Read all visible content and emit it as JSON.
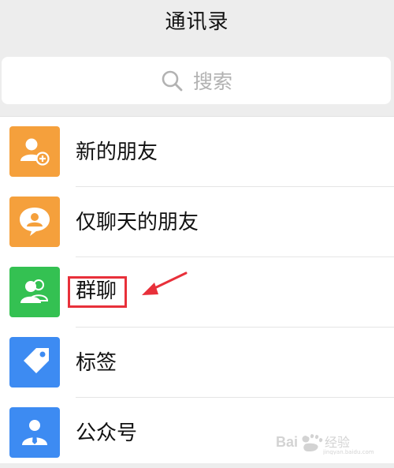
{
  "header": {
    "title": "通讯录"
  },
  "search": {
    "placeholder": "搜索",
    "icon": "search-icon"
  },
  "contacts": [
    {
      "label": "新的朋友",
      "icon": "add-friend-icon",
      "color": "#f5a03c"
    },
    {
      "label": "仅聊天的朋友",
      "icon": "chat-friend-icon",
      "color": "#f5a03c"
    },
    {
      "label": "群聊",
      "icon": "group-chat-icon",
      "color": "#34c152"
    },
    {
      "label": "标签",
      "icon": "tag-icon",
      "color": "#3d8bf2"
    },
    {
      "label": "公众号",
      "icon": "official-account-icon",
      "color": "#3d8bf2"
    }
  ],
  "annotation": {
    "highlight_color": "#e8303a",
    "target": "群聊"
  },
  "watermark": {
    "text": "Bai 经验",
    "subtext": "jingyan.baidu.com"
  }
}
